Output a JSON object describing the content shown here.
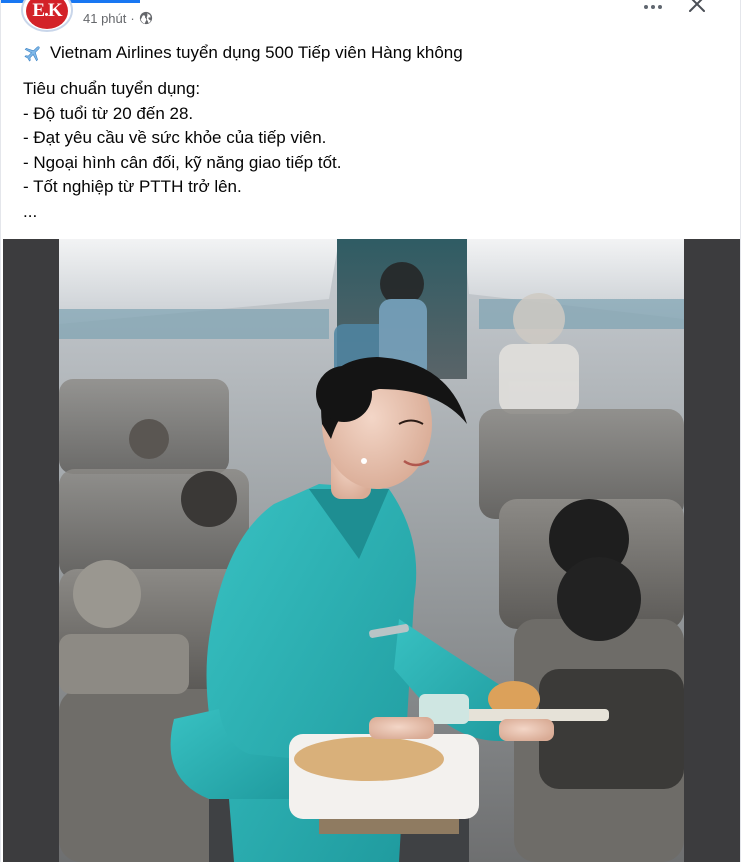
{
  "post": {
    "avatar_text": "E.K",
    "timestamp": "41 phút",
    "separator": "·",
    "privacy_icon": "globe-icon",
    "more_icon": "more-dots-icon",
    "close_icon": "close-icon",
    "title_icon": "airplane-icon",
    "title": "Vietnam Airlines tuyển dụng 500 Tiếp viên Hàng không",
    "body_lines": [
      "Tiêu chuẩn tuyển dụng:",
      "- Độ tuổi từ 20 đến 28.",
      "- Đạt yêu cầu về sức khỏe của tiếp viên.",
      "- Ngoại hình cân đối, kỹ năng giao tiếp tốt.",
      "- Tốt nghiệp từ PTTH trở lên.",
      "..."
    ]
  },
  "colors": {
    "accent": "#1877f2",
    "meta_text": "#65676b",
    "uniform": "#2aaeb0",
    "avatar_red": "#d32228"
  }
}
